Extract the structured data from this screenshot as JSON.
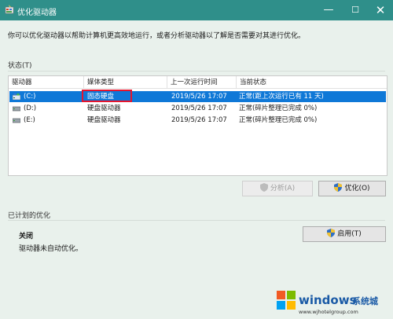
{
  "window": {
    "title": "优化驱动器",
    "minimize_glyph": "—",
    "maximize_glyph": "☐",
    "close_glyph": "✕"
  },
  "description": "你可以优化驱动器以帮助计算机更高效地运行，或者分析驱动器以了解是否需要对其进行优化。",
  "status_section": {
    "label": "状态(T)",
    "columns": [
      "驱动器",
      "媒体类型",
      "上一次运行时间",
      "当前状态"
    ],
    "rows": [
      {
        "drive": "(C:)",
        "media": "固态硬盘",
        "last_run": "2019/5/26 17:07",
        "status": "正常(距上次运行已有 11 天)",
        "selected": true
      },
      {
        "drive": "(D:)",
        "media": "硬盘驱动器",
        "last_run": "2019/5/26 17:07",
        "status": "正常(碎片整理已完成 0%)",
        "selected": false
      },
      {
        "drive": "(E:)",
        "media": "硬盘驱动器",
        "last_run": "2019/5/26 17:07",
        "status": "正常(碎片整理已完成 0%)",
        "selected": false
      }
    ],
    "analyze_button": "分析(A)",
    "optimize_button": "优化(O)"
  },
  "schedule_section": {
    "label": "已计划的优化",
    "state": "关闭",
    "detail": "驱动器未自动优化。",
    "enable_button": "启用(T)"
  },
  "watermark": {
    "brand": "windows",
    "site": "系统城",
    "url": "www.wjhotelgroup.com"
  },
  "colors": {
    "titlebar": "#2f8f8a",
    "selection": "#0f78d7",
    "highlight_box": "#e5142d"
  }
}
